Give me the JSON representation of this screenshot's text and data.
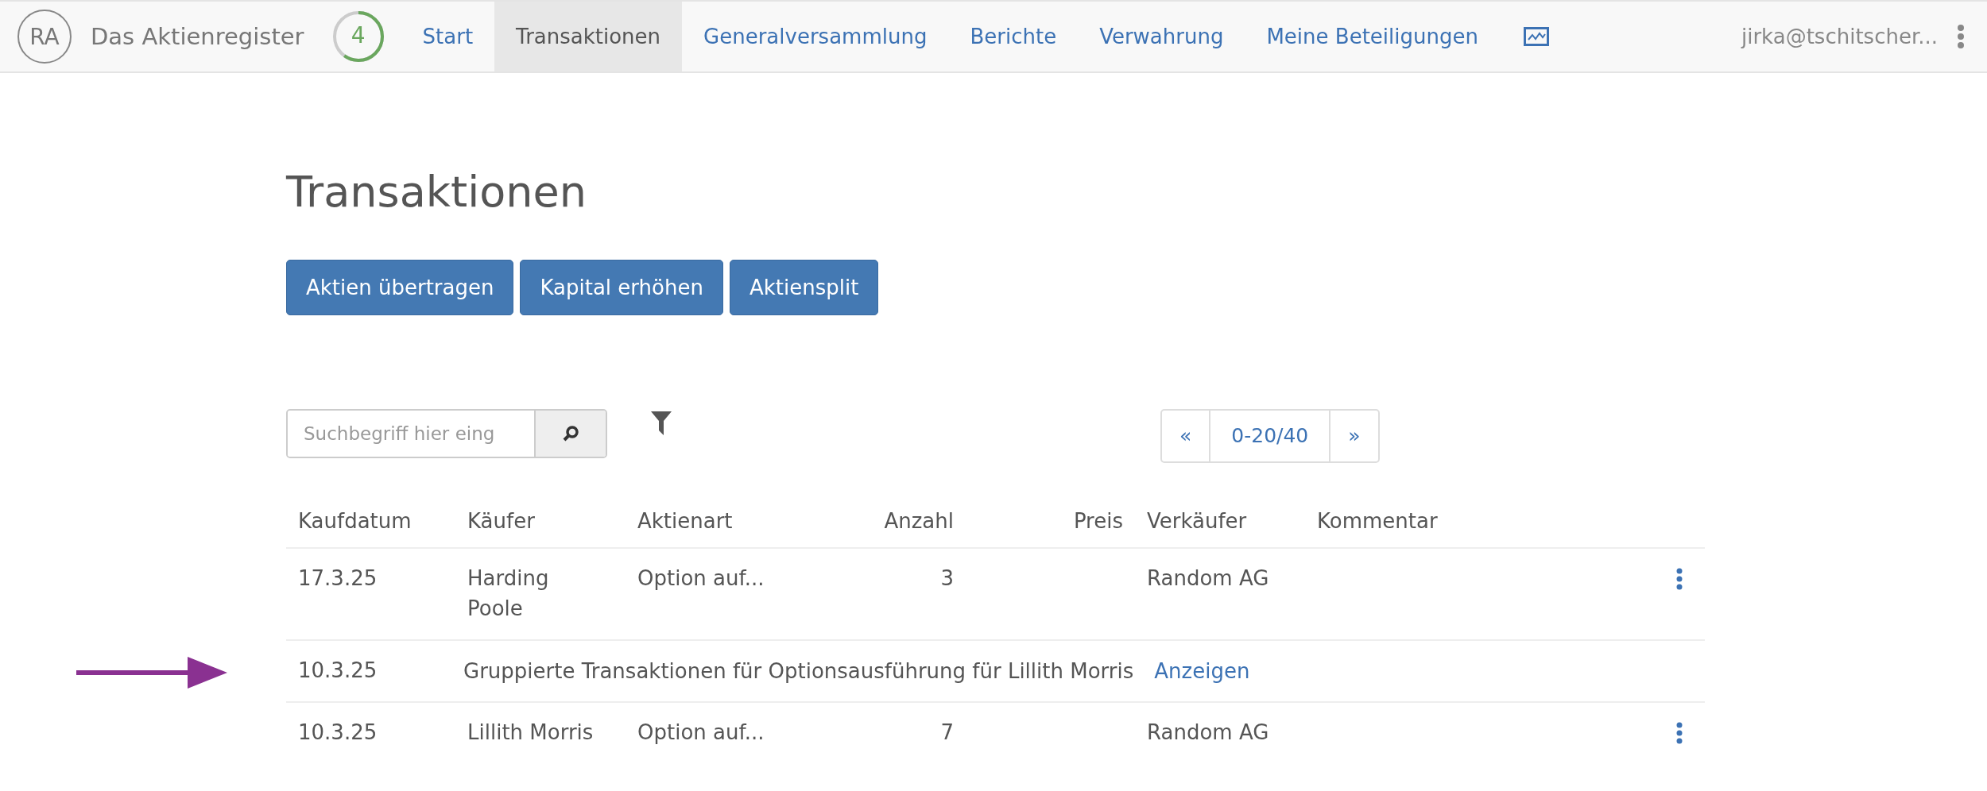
{
  "navbar": {
    "logo_initials": "RA",
    "brand": "Das Aktienregister",
    "progress": {
      "count": "4",
      "level": 0.6
    },
    "items": [
      {
        "label": "Start",
        "selected": false
      },
      {
        "label": "Transaktionen",
        "selected": true
      },
      {
        "label": "Generalversammlung",
        "selected": false
      },
      {
        "label": "Berichte",
        "selected": false
      },
      {
        "label": "Verwahrung",
        "selected": false
      },
      {
        "label": "Meine Beteiligungen",
        "selected": false
      }
    ],
    "user": "jirka@tschitscher..."
  },
  "page_title": "Transaktionen",
  "actions": [
    "Aktien übertragen",
    "Kapital erhöhen",
    "Aktiensplit"
  ],
  "search": {
    "placeholder": "Suchbegriff hier eing"
  },
  "pagination": {
    "prev": "«",
    "range": "0-20/40",
    "next": "»"
  },
  "table": {
    "columns": [
      "Kaufdatum",
      "Käufer",
      "Aktienart",
      "Anzahl",
      "Preis",
      "Verkäufer",
      "Kommentar"
    ],
    "rows": [
      {
        "kind": "transaction",
        "date": "17.3.25",
        "buyer": "Harding Poole",
        "share_type": "Option auf...",
        "count": "3",
        "seller": "Random AG",
        "highlighted": false
      },
      {
        "kind": "group",
        "date": "10.3.25",
        "text": "Gruppierte Transaktionen für Optionsausführung für Lillith Morris",
        "link": "Anzeigen",
        "highlighted": true
      },
      {
        "kind": "transaction",
        "date": "10.3.25",
        "buyer": "Lillith Morris",
        "share_type": "Option auf...",
        "count": "7",
        "seller": "Random AG",
        "highlighted": false
      }
    ]
  }
}
